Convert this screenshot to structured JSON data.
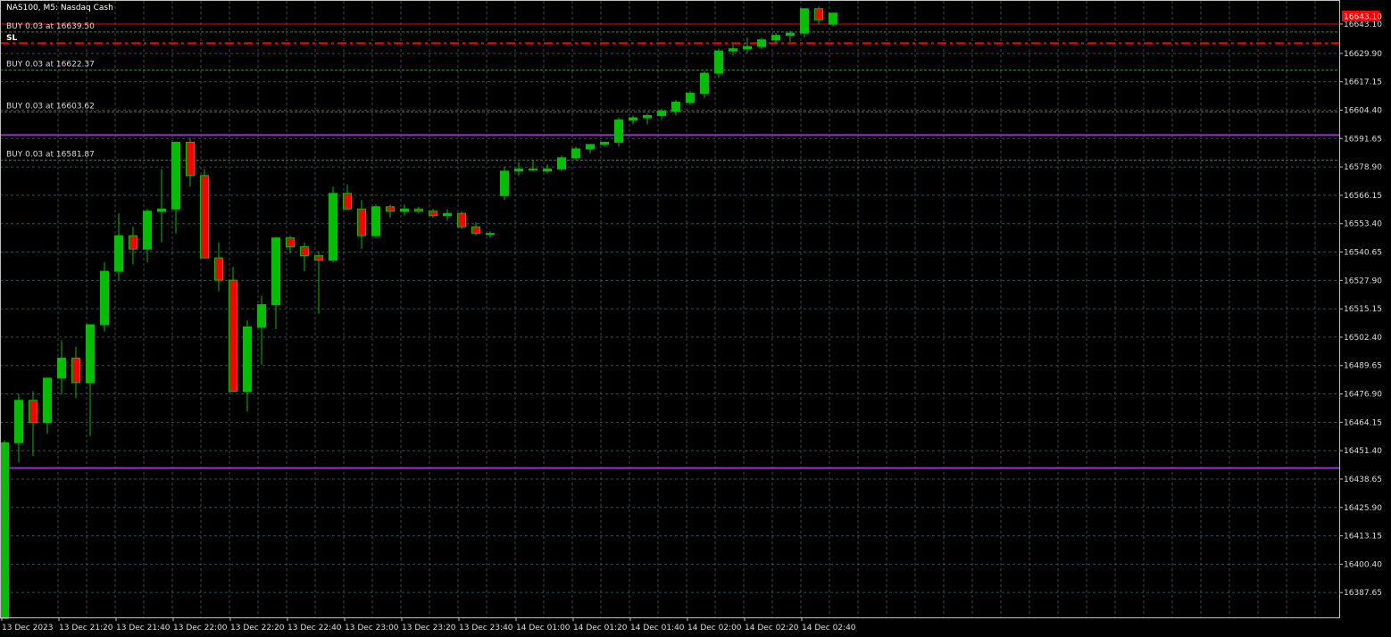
{
  "header": {
    "symbol_label": "NAS100, M5:  Nasdaq Cash"
  },
  "sl_label": "SL",
  "current_price": "16643.10",
  "colors": {
    "background": "#000000",
    "grid": "#2f4f4f",
    "bull": "#00c000",
    "bear": "#ff0000",
    "wick": "#00c000",
    "purple_line": "#9932cc",
    "trade_line": "#2f8f2f",
    "sl_line": "#ff0000",
    "price_line": "#ff0000",
    "axis_text": "#dcdcdc"
  },
  "trade_lines": [
    {
      "label": "BUY 0.03 at 16639.50",
      "price": 16639.5
    },
    {
      "label": "BUY 0.03 at 16622.37",
      "price": 16622.37
    },
    {
      "label": "BUY 0.03 at 16603.62",
      "price": 16603.62
    },
    {
      "label": "BUY 0.03 at 16581.87",
      "price": 16581.87
    }
  ],
  "sl_price": 16634.5,
  "purple_lines": [
    16593.2,
    16443.6
  ],
  "chart_data": {
    "type": "candlestick",
    "symbol": "NAS100",
    "timeframe": "M5",
    "ylim": [
      16376.5,
      16653.5
    ],
    "y_ticks": [
      "16643.10",
      "16629.90",
      "16617.15",
      "16604.40",
      "16591.65",
      "16578.90",
      "16566.15",
      "16553.40",
      "16540.65",
      "16527.90",
      "16515.15",
      "16502.40",
      "16489.65",
      "16476.90",
      "16464.15",
      "16451.40",
      "16438.65",
      "16425.90",
      "16413.15",
      "16400.40",
      "16387.65"
    ],
    "x_ticks": [
      "13 Dec 2023",
      "13 Dec 21:20",
      "13 Dec 21:40",
      "13 Dec 22:00",
      "13 Dec 22:20",
      "13 Dec 22:40",
      "13 Dec 23:00",
      "13 Dec 23:20",
      "13 Dec 23:40",
      "14 Dec 01:00",
      "14 Dec 01:20",
      "14 Dec 01:40",
      "14 Dec 02:00",
      "14 Dec 02:20",
      "14 Dec 02:40"
    ],
    "candles": [
      {
        "o": 16376,
        "h": 16456,
        "l": 16376,
        "c": 16455
      },
      {
        "o": 16455,
        "h": 16477,
        "l": 16446,
        "c": 16474
      },
      {
        "o": 16474,
        "h": 16478,
        "l": 16449,
        "c": 16464
      },
      {
        "o": 16464,
        "h": 16483,
        "l": 16459,
        "c": 16484
      },
      {
        "o": 16484,
        "h": 16501,
        "l": 16477,
        "c": 16493
      },
      {
        "o": 16493,
        "h": 16498,
        "l": 16475,
        "c": 16482
      },
      {
        "o": 16482,
        "h": 16508,
        "l": 16458,
        "c": 16508
      },
      {
        "o": 16508,
        "h": 16536,
        "l": 16505,
        "c": 16532
      },
      {
        "o": 16532,
        "h": 16558,
        "l": 16528,
        "c": 16548
      },
      {
        "o": 16548,
        "h": 16552,
        "l": 16535,
        "c": 16542
      },
      {
        "o": 16542,
        "h": 16560,
        "l": 16536,
        "c": 16559
      },
      {
        "o": 16559,
        "h": 16578,
        "l": 16545,
        "c": 16560
      },
      {
        "o": 16560,
        "h": 16590,
        "l": 16549,
        "c": 16590
      },
      {
        "o": 16590,
        "h": 16592,
        "l": 16570,
        "c": 16575
      },
      {
        "o": 16575,
        "h": 16578,
        "l": 16538,
        "c": 16538
      },
      {
        "o": 16538,
        "h": 16545,
        "l": 16523,
        "c": 16528
      },
      {
        "o": 16528,
        "h": 16534,
        "l": 16478,
        "c": 16478
      },
      {
        "o": 16478,
        "h": 16510,
        "l": 16469,
        "c": 16507
      },
      {
        "o": 16507,
        "h": 16521,
        "l": 16490,
        "c": 16517
      },
      {
        "o": 16517,
        "h": 16547,
        "l": 16506,
        "c": 16547
      },
      {
        "o": 16547,
        "h": 16548,
        "l": 16540,
        "c": 16543
      },
      {
        "o": 16543,
        "h": 16545,
        "l": 16532,
        "c": 16539
      },
      {
        "o": 16539,
        "h": 16541,
        "l": 16513,
        "c": 16537
      },
      {
        "o": 16537,
        "h": 16570,
        "l": 16536,
        "c": 16567
      },
      {
        "o": 16567,
        "h": 16571,
        "l": 16560,
        "c": 16560
      },
      {
        "o": 16560,
        "h": 16564,
        "l": 16542,
        "c": 16548
      },
      {
        "o": 16548,
        "h": 16562,
        "l": 16547,
        "c": 16561
      },
      {
        "o": 16561,
        "h": 16562,
        "l": 16556,
        "c": 16559
      },
      {
        "o": 16559,
        "h": 16562,
        "l": 16557,
        "c": 16560
      },
      {
        "o": 16560,
        "h": 16561,
        "l": 16558,
        "c": 16559
      },
      {
        "o": 16559,
        "h": 16560,
        "l": 16556,
        "c": 16557
      },
      {
        "o": 16557,
        "h": 16560,
        "l": 16555,
        "c": 16558
      },
      {
        "o": 16558,
        "h": 16559,
        "l": 16551,
        "c": 16552
      },
      {
        "o": 16552,
        "h": 16554,
        "l": 16548,
        "c": 16549
      },
      {
        "o": 16549,
        "h": 16550,
        "l": 16547,
        "c": 16549
      },
      {
        "o": 16566,
        "h": 16579,
        "l": 16564,
        "c": 16577
      },
      {
        "o": 16577,
        "h": 16581,
        "l": 16575,
        "c": 16578
      },
      {
        "o": 16578,
        "h": 16582,
        "l": 16577,
        "c": 16578
      },
      {
        "o": 16577,
        "h": 16580,
        "l": 16576,
        "c": 16578
      },
      {
        "o": 16578,
        "h": 16584,
        "l": 16577,
        "c": 16583
      },
      {
        "o": 16583,
        "h": 16588,
        "l": 16582,
        "c": 16587
      },
      {
        "o": 16587,
        "h": 16589,
        "l": 16585,
        "c": 16589
      },
      {
        "o": 16589,
        "h": 16590,
        "l": 16588,
        "c": 16590
      },
      {
        "o": 16590,
        "h": 16601,
        "l": 16588,
        "c": 16600
      },
      {
        "o": 16600,
        "h": 16602,
        "l": 16598,
        "c": 16601
      },
      {
        "o": 16601,
        "h": 16603,
        "l": 16598,
        "c": 16602
      },
      {
        "o": 16602,
        "h": 16605,
        "l": 16600,
        "c": 16604
      },
      {
        "o": 16604,
        "h": 16609,
        "l": 16602,
        "c": 16608
      },
      {
        "o": 16608,
        "h": 16613,
        "l": 16607,
        "c": 16612
      },
      {
        "o": 16612,
        "h": 16622,
        "l": 16610,
        "c": 16621
      },
      {
        "o": 16621,
        "h": 16632,
        "l": 16619,
        "c": 16631
      },
      {
        "o": 16631,
        "h": 16634,
        "l": 16629,
        "c": 16632
      },
      {
        "o": 16632,
        "h": 16637,
        "l": 16630,
        "c": 16633
      },
      {
        "o": 16633,
        "h": 16637,
        "l": 16632,
        "c": 16636
      },
      {
        "o": 16636,
        "h": 16639,
        "l": 16634,
        "c": 16638
      },
      {
        "o": 16638,
        "h": 16640,
        "l": 16635,
        "c": 16639
      },
      {
        "o": 16639,
        "h": 16650,
        "l": 16637,
        "c": 16650
      },
      {
        "o": 16650,
        "h": 16651,
        "l": 16643,
        "c": 16645
      },
      {
        "o": 16643,
        "h": 16648,
        "l": 16642,
        "c": 16648
      }
    ]
  }
}
